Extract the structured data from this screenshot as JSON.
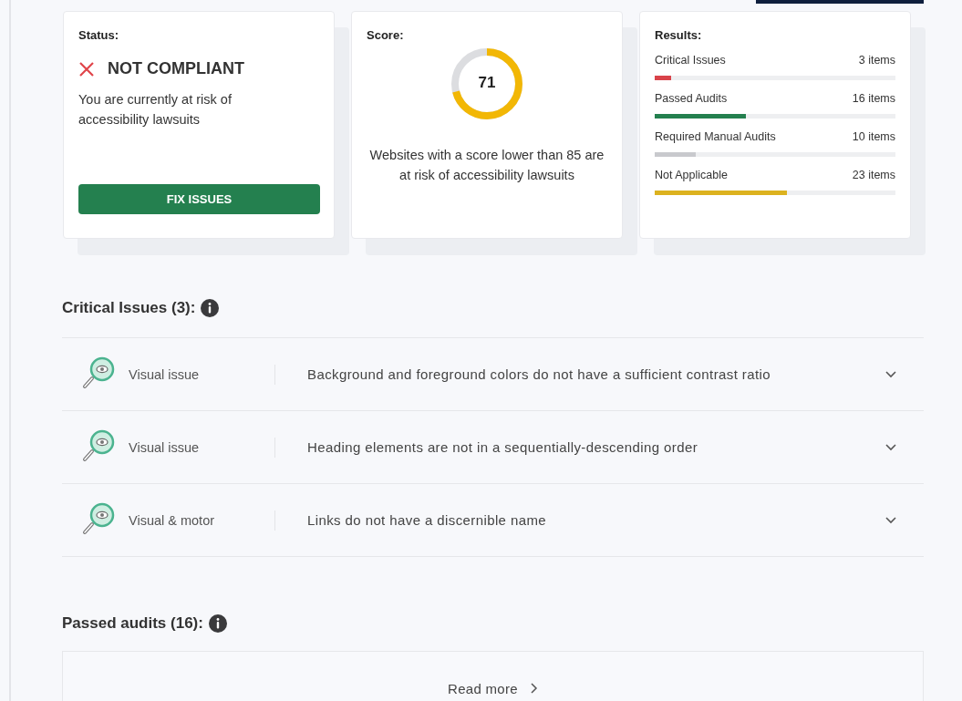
{
  "status": {
    "title": "Status:",
    "verdict": "NOT COMPLIANT",
    "compliant": false,
    "message": "You are currently at risk of accessibility lawsuits",
    "button": "FIX ISSUES"
  },
  "score": {
    "title": "Score:",
    "value": "71",
    "level": 0.71,
    "note": "Websites with a score lower than 85 are at risk of accessibility lawsuits"
  },
  "results": {
    "title": "Results:",
    "items": [
      {
        "label": "Critical Issues",
        "count": "3 items",
        "level": 0.07,
        "color": "#d9434a"
      },
      {
        "label": "Passed Audits",
        "count": "16 items",
        "level": 0.38,
        "color": "#24804f"
      },
      {
        "label": "Required Manual Audits",
        "count": "10 items",
        "level": 0.17,
        "color": "#c8c9cd"
      },
      {
        "label": "Not Applicable",
        "count": "23 items",
        "level": 0.55,
        "color": "#dcb21f"
      }
    ]
  },
  "critical_issues": {
    "heading": "Critical Issues (3):",
    "rows": [
      {
        "category": "Visual issue",
        "description": "Background and foreground colors do not have a sufficient contrast ratio",
        "expanded": false
      },
      {
        "category": "Visual issue",
        "description": "Heading elements are not in a sequentially-descending order",
        "expanded": false
      },
      {
        "category": "Visual & motor",
        "description": "Links do not have a discernible name",
        "expanded": false
      }
    ]
  },
  "passed_audits": {
    "heading": "Passed audits (16):",
    "link": "Read more"
  }
}
